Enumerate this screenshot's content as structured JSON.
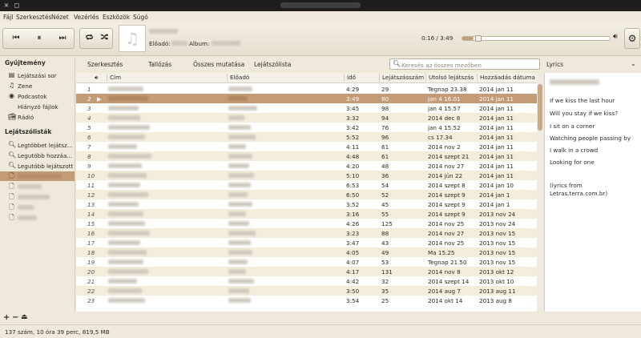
{
  "window": {
    "close": "×",
    "maximize": "◻"
  },
  "menu": [
    "Fájl",
    "Szerkesztés",
    "Nézet",
    "Vezérlés",
    "Eszközök",
    "Súgó"
  ],
  "player": {
    "artist_label": "Előadó:",
    "album_label": "Album:",
    "time": "0:16 / 3:49",
    "progress_fraction": 0.074
  },
  "sidebar": {
    "library_header": "Gyűjtemény",
    "library_items": [
      {
        "icon": "queue-icon",
        "label": "Lejátszási sor"
      },
      {
        "icon": "music-icon",
        "label": "Zene"
      },
      {
        "icon": "podcast-icon",
        "label": "Podcastok"
      },
      {
        "icon": "missing-icon",
        "label": "Hiányzó fájlok"
      },
      {
        "icon": "radio-icon",
        "label": "Rádió"
      }
    ],
    "playlists_header": "Lejátszólisták",
    "playlist_items": [
      {
        "label": "Legtöbbet lejátsz..."
      },
      {
        "label": "Legutóbb hozzáa..."
      },
      {
        "label": "Legutóbb lejátszott"
      }
    ]
  },
  "tabs": [
    "Szerkesztés",
    "Tallózás",
    "Összes mutatása",
    "Lejátszólista"
  ],
  "search": {
    "placeholder": "Keresés az összes mezőben"
  },
  "lyrics_header": "Lyrics",
  "columns": [
    "Cím",
    "Előadó",
    "Idő",
    "Lejátszásszám",
    "Utolsó lejátszás",
    "Hozzáadás dátuma"
  ],
  "rows": [
    [
      "1",
      "4:29",
      "29",
      "Tegnap 23.38",
      "2014 jan 11"
    ],
    [
      "2",
      "3:49",
      "80",
      "jan  4 16.01",
      "2014 jan 11"
    ],
    [
      "3",
      "3:45",
      "98",
      "jan  4 15.57",
      "2014 jan 11"
    ],
    [
      "4",
      "3:32",
      "94",
      "2014 dec  8",
      "2014 jan 11"
    ],
    [
      "5",
      "3:42",
      "76",
      "jan  4 15.52",
      "2014 jan 11"
    ],
    [
      "6",
      "5:52",
      "96",
      "cs 17.34",
      "2014 jan 11"
    ],
    [
      "7",
      "4:11",
      "61",
      "2014 nov  2",
      "2014 jan 11"
    ],
    [
      "8",
      "4:48",
      "61",
      "2014 szept 21",
      "2014 jan 11"
    ],
    [
      "9",
      "4:20",
      "48",
      "2014 nov 27",
      "2014 jan 11"
    ],
    [
      "10",
      "5:10",
      "36",
      "2014 jún 22",
      "2014 jan 11"
    ],
    [
      "11",
      "6:53",
      "54",
      "2014 szept  8",
      "2014 jan 10"
    ],
    [
      "12",
      "6:50",
      "52",
      "2014 szept  9",
      "2014 jan  1"
    ],
    [
      "13",
      "3:52",
      "45",
      "2014 szept  9",
      "2014 jan  1"
    ],
    [
      "14",
      "3:16",
      "55",
      "2014 szept  9",
      "2013 nov 24"
    ],
    [
      "15",
      "4:26",
      "125",
      "2014 nov 25",
      "2013 nov 24"
    ],
    [
      "16",
      "3:23",
      "88",
      "2014 nov 27",
      "2013 nov 15"
    ],
    [
      "17",
      "3:47",
      "43",
      "2014 nov 25",
      "2013 nov 15"
    ],
    [
      "18",
      "4:05",
      "49",
      "Ma 15.25",
      "2013 nov 15"
    ],
    [
      "19",
      "4:07",
      "53",
      "Tegnap 21.50",
      "2013 nov 15"
    ],
    [
      "20",
      "4:17",
      "131",
      "2014 nov  8",
      "2013 okt 12"
    ],
    [
      "21",
      "4:42",
      "32",
      "2014 szept 14",
      "2013 okt 10"
    ],
    [
      "22",
      "3:50",
      "35",
      "2014 aug  7",
      "2013 aug 11"
    ],
    [
      "23",
      "3:54",
      "25",
      "2014 okt 14",
      "2013 aug  8"
    ]
  ],
  "selected_row_index": 1,
  "lyrics": {
    "lines": [
      "If we kiss the last hour",
      "Will you stay if we kiss?",
      "I sit on a corner",
      "Watching people passing by",
      "I walk in a crowd",
      "Looking for one"
    ],
    "source_1": "(lyrics from",
    "source_2": "Letras.terra.com.br)"
  },
  "bottom_buttons": [
    "+",
    "−",
    "⏏"
  ],
  "status": "137 szám, 10 óra 39 perc, 819,5 MB",
  "colors": {
    "accent": "#c39b77",
    "background": "#efe9dc"
  }
}
